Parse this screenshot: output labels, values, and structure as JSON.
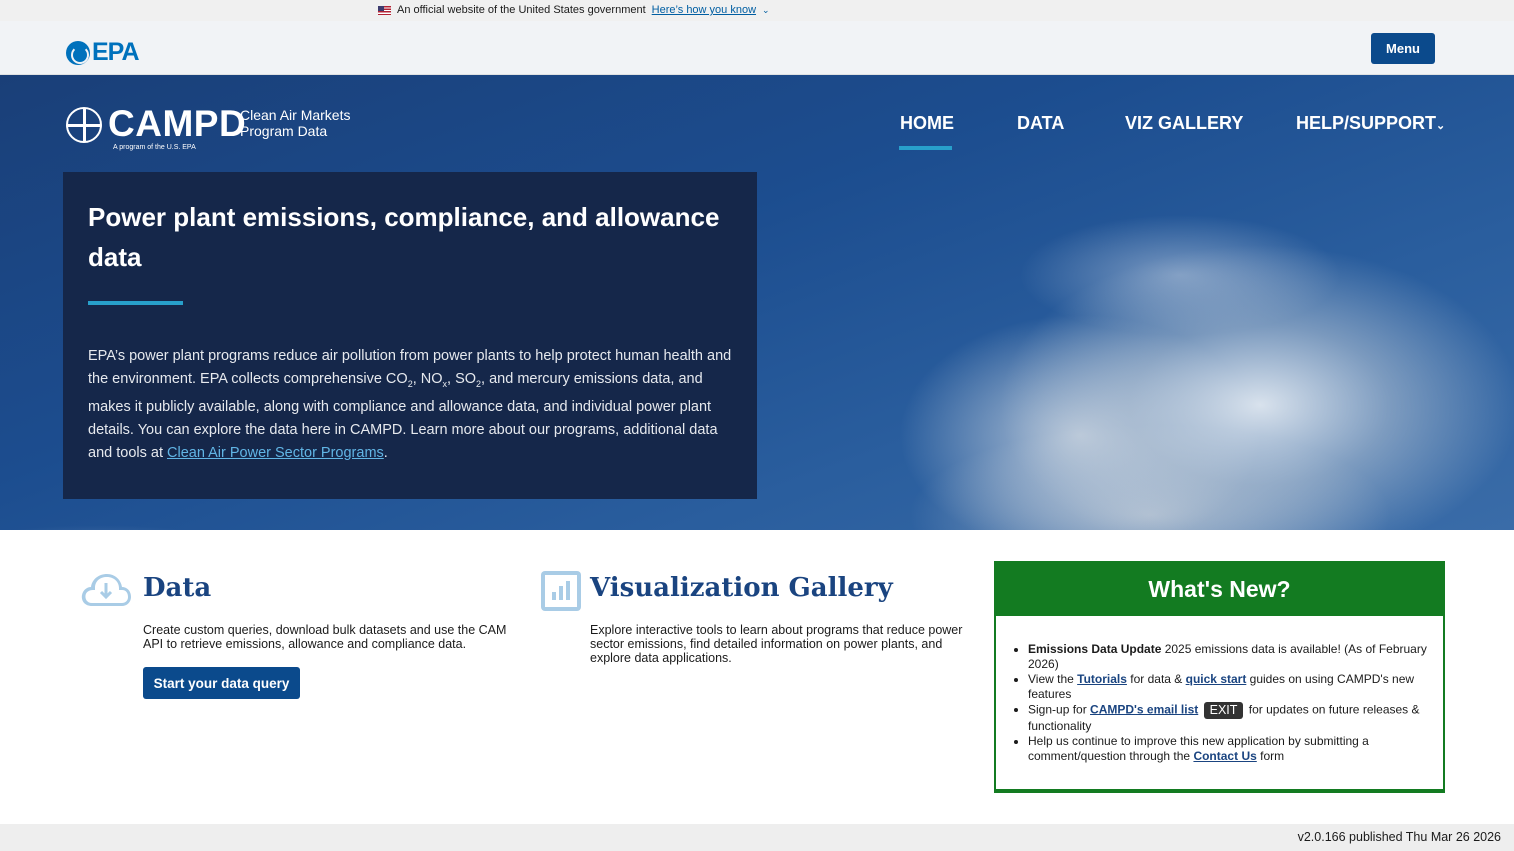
{
  "gov_banner": {
    "text": "An official website of the United States government",
    "link": "Here’s how you know"
  },
  "epa_header": {
    "logo_text": "EPA",
    "menu_label": "Menu"
  },
  "campd": {
    "logo_word": "CAMPD",
    "subtitle": "Clean Air Markets Program Data",
    "program_note": "A program of the U.S. EPA"
  },
  "nav": {
    "items": [
      "HOME",
      "DATA",
      "VIZ GALLERY",
      "HELP/SUPPORT"
    ],
    "active": "HOME"
  },
  "hero": {
    "title": "Power plant emissions, compliance, and allowance data",
    "text_1": "EPA’s power plant programs reduce air pollution from power plants to help protect human health and the environment. EPA collects comprehensive CO",
    "sub_co2": "2",
    "text_2": ", NO",
    "sub_nox": "x",
    "text_3": ", SO",
    "sub_so2": "2",
    "text_4": ", and mercury emissions data, and makes it publicly available, along with compliance and allowance data, and individual power plant details. You can explore the data here in CAMPD. Learn more about our programs, additional data and tools at ",
    "link": "Clean Air Power Sector Programs",
    "text_end": "."
  },
  "data_card": {
    "title": "Data",
    "description": "Create custom queries, download bulk datasets and use the CAM API to retrieve emissions, allowance and compliance data.",
    "button": "Start your data query"
  },
  "viz_card": {
    "title": "Visualization Gallery",
    "description": "Explore interactive tools to learn about programs that reduce power sector emissions, find detailed information on power plants, and explore data applications."
  },
  "whats_new": {
    "title": "What's New?",
    "item1_bold": "Emissions Data Update",
    "item1_text": " 2025 emissions data is available! (As of February 2026)",
    "item2_pre": "View the ",
    "item2_link1": "Tutorials",
    "item2_mid": " for data & ",
    "item2_link2": "quick start",
    "item2_post": " guides on using CAMPD's new features",
    "item3_pre": "Sign-up for ",
    "item3_link": "CAMPD's email list",
    "item3_badge": "EXIT",
    "item3_post": " for updates on future releases & functionality",
    "item4_pre": "Help us continue to improve this new application by submitting a comment/question through the ",
    "item4_link": "Contact Us",
    "item4_post": " form"
  },
  "footer": {
    "version": "v2.0.166 published Thu Mar 26 2026"
  },
  "colors": {
    "epa_blue": "#0071bc",
    "button_blue": "#0b4a8c",
    "accent_cyan": "#28a0cb",
    "whatsnew_green": "#137b21",
    "hero_card": "#15274a"
  }
}
